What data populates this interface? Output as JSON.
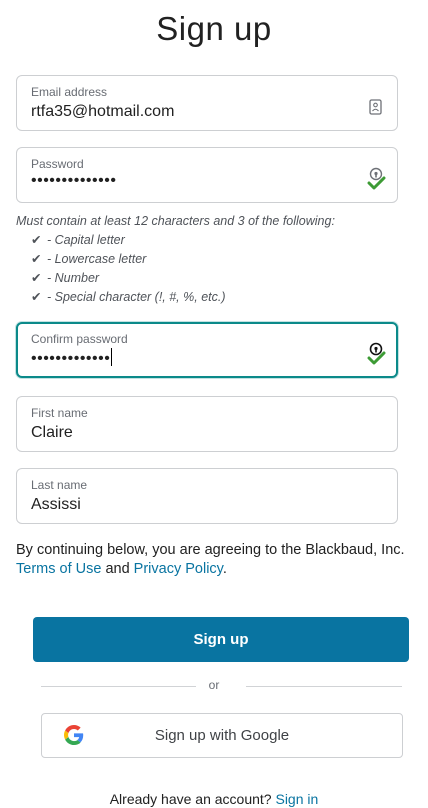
{
  "page": {
    "title": "Sign up"
  },
  "form": {
    "email": {
      "label": "Email address",
      "value": "rtfa35@hotmail.com"
    },
    "password": {
      "label": "Password",
      "value": "••••••••••••••"
    },
    "password_rules": {
      "intro": "Must contain at least 12 characters and 3 of the following:",
      "items": [
        {
          "icon": "check-icon",
          "text": "- Capital letter"
        },
        {
          "icon": "check-icon",
          "text": "- Lowercase letter"
        },
        {
          "icon": "check-icon",
          "text": "- Number"
        },
        {
          "icon": "check-icon",
          "text": "- Special character (!, #, %, etc.)"
        }
      ],
      "check_glyph": "✔"
    },
    "confirm_password": {
      "label": "Confirm password",
      "value": "•••••••••••••"
    },
    "first_name": {
      "label": "First name",
      "value": "Claire"
    },
    "last_name": {
      "label": "Last name",
      "value": "Assissi"
    }
  },
  "agreement": {
    "prefix": "By continuing below, you are agreeing to the Blackbaud, Inc. ",
    "terms_link": "Terms of Use",
    "and": " and ",
    "privacy_link": "Privacy Policy",
    "suffix": "."
  },
  "actions": {
    "signup_label": "Sign up",
    "or_label": "or",
    "google_label": "Sign up with Google"
  },
  "footer": {
    "prompt": "Already have an account? ",
    "signin_link": "Sign in"
  },
  "colors": {
    "primary": "#0974a1",
    "focus": "#0b8a8a",
    "valid": "#3d9b35"
  }
}
